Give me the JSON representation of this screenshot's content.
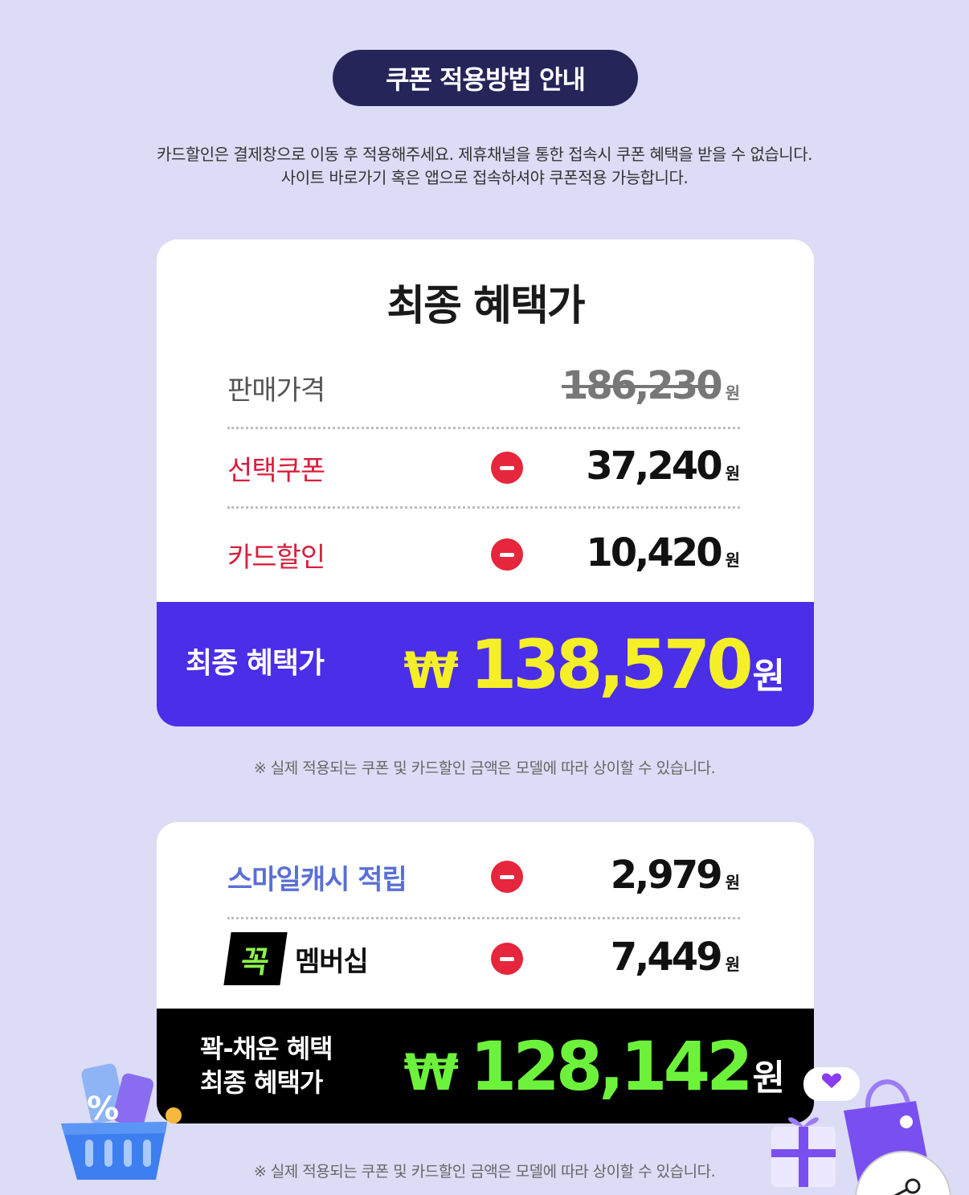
{
  "header": {
    "pill_title": "쿠폰 적용방법 안내",
    "notice_line1": "카드할인은 결제창으로 이동 후 적용해주세요. 제휴채널을 통한 접속시 쿠폰 혜택을 받을 수 없습니다.",
    "notice_line2": "사이트 바로가기 혹은 앱으로 접속하셔야 쿠폰적용 가능합니다."
  },
  "card1": {
    "title": "최종 혜택가",
    "rows": [
      {
        "label": "판매가격",
        "amount": "186,230",
        "unit": "원",
        "strikethrough": true
      },
      {
        "label": "선택쿠폰",
        "amount": "37,240",
        "unit": "원",
        "minus": true
      },
      {
        "label": "카드할인",
        "amount": "10,420",
        "unit": "원",
        "minus": true
      }
    ],
    "total": {
      "label": "최종 혜택가",
      "currency": "₩",
      "amount": "138,570",
      "unit": "원"
    },
    "footnote": "※ 실제 적용되는 쿠폰 및 카드할인 금액은 모델에 따라 상이할 수 있습니다."
  },
  "card2": {
    "rows": [
      {
        "label": "스마일캐시 적립",
        "amount": "2,979",
        "unit": "원",
        "minus": true
      },
      {
        "logo": "꼭",
        "label": "멤버십",
        "amount": "7,449",
        "unit": "원",
        "minus": true
      }
    ],
    "total": {
      "label_line1": "꽉-채운 혜택",
      "label_line2": "최종 혜택가",
      "currency": "₩",
      "amount": "128,142",
      "unit": "원"
    },
    "footnote": "※ 실제 적용되는 쿠폰 및 카드할인 금액은 모델에 따라 상이할 수 있습니다."
  },
  "colors": {
    "background": "#dcdcf6",
    "pill": "#25255a",
    "label_red": "#d81f3d",
    "label_blue": "#5a6fd6",
    "band1": "#4a2ee8",
    "band1_amount": "#f5ef28",
    "band2_amount": "#6df23c",
    "minus": "#e5263c"
  },
  "icons": [
    "minus-circle-icon",
    "basket-icon",
    "shopping-bag-icon",
    "gift-box-icon",
    "heart-bubble-icon",
    "share-icon"
  ]
}
